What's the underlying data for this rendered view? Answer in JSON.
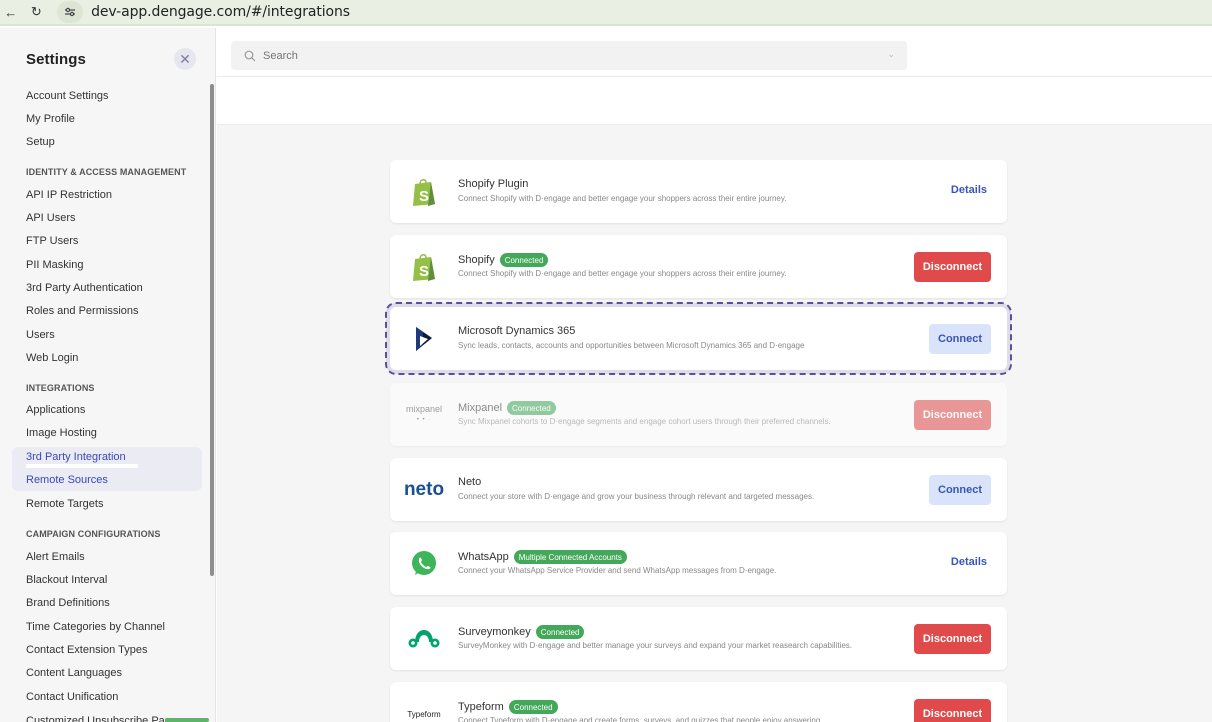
{
  "browser": {
    "back": "←",
    "reload": "↻",
    "site_info": "⚙",
    "url": "dev-app.dengage.com/#/integrations"
  },
  "sidebar": {
    "title": "Settings",
    "close": "✕",
    "items": [
      {
        "type": "item",
        "label": "Account Settings"
      },
      {
        "type": "item",
        "label": "My Profile"
      },
      {
        "type": "item",
        "label": "Setup"
      },
      {
        "type": "section",
        "label": "IDENTITY & ACCESS MANAGEMENT"
      },
      {
        "type": "item",
        "label": "API IP Restriction"
      },
      {
        "type": "item",
        "label": "API Users"
      },
      {
        "type": "item",
        "label": "FTP Users"
      },
      {
        "type": "item",
        "label": "PII Masking"
      },
      {
        "type": "item",
        "label": "3rd Party Authentication"
      },
      {
        "type": "item",
        "label": "Roles and Permissions"
      },
      {
        "type": "item",
        "label": "Users"
      },
      {
        "type": "item",
        "label": "Web Login"
      },
      {
        "type": "section",
        "label": "INTEGRATIONS"
      },
      {
        "type": "item",
        "label": "Applications"
      },
      {
        "type": "item",
        "label": "Image Hosting"
      },
      {
        "type": "item",
        "label": "3rd Party Integration",
        "link": true
      },
      {
        "type": "item",
        "label": "Remote Sources",
        "link": true
      },
      {
        "type": "item",
        "label": "Remote Targets"
      },
      {
        "type": "section",
        "label": "CAMPAIGN CONFIGURATIONS"
      },
      {
        "type": "item",
        "label": "Alert Emails"
      },
      {
        "type": "item",
        "label": "Blackout Interval"
      },
      {
        "type": "item",
        "label": "Brand Definitions"
      },
      {
        "type": "item",
        "label": "Time Categories by Channel"
      },
      {
        "type": "item",
        "label": "Contact Extension Types"
      },
      {
        "type": "item",
        "label": "Content Languages"
      },
      {
        "type": "item",
        "label": "Contact Unification"
      },
      {
        "type": "item",
        "label": "Customized Unsubscribe Page"
      }
    ]
  },
  "search": {
    "placeholder": "Search",
    "chevron": "⌄"
  },
  "integrations": [
    {
      "name": "Shopify Plugin",
      "badge": "",
      "description": "Connect Shopify with D·engage and better engage your shoppers across their entire journey.",
      "action": "details",
      "action_label": "Details",
      "logo": "shopify-icon"
    },
    {
      "name": "Shopify",
      "badge": "Connected",
      "description": "Connect Shopify with D·engage and better engage your shoppers across their entire journey.",
      "action": "disconnect",
      "action_label": "Disconnect",
      "logo": "shopify-icon"
    },
    {
      "name": "Microsoft Dynamics 365",
      "badge": "",
      "description": "Sync leads, contacts, accounts and opportunities between Microsoft Dynamics 365 and D·engage",
      "action": "connect",
      "action_label": "Connect",
      "logo": "dynamics-icon"
    },
    {
      "name": "Mixpanel",
      "badge": "Connected",
      "description": "Sync Mixpanel cohorts to D·engage segments and engage cohort users through their preferred channels.",
      "action": "disconnect",
      "action_label": "Disconnect",
      "logo": "mixpanel-logo"
    },
    {
      "name": "Neto",
      "badge": "",
      "description": "Connect your store with D·engage and grow your business through relevant and targeted messages.",
      "action": "connect",
      "action_label": "Connect",
      "logo": "neto-logo"
    },
    {
      "name": "WhatsApp",
      "badge": "Multiple Connected Accounts",
      "description": "Connect your WhatsApp Service Provider and send WhatsApp messages from D·engage.",
      "action": "details",
      "action_label": "Details",
      "logo": "whatsapp-icon"
    },
    {
      "name": "Surveymonkey",
      "badge": "Connected",
      "description": "SurveyMonkey with D·engage and better manage your surveys and expand your market reasearch capabilities.",
      "action": "disconnect",
      "action_label": "Disconnect",
      "logo": "surveymonkey-icon"
    },
    {
      "name": "Typeform",
      "badge": "Connected",
      "description": "Connect Typeform with D·engage and create forms, surveys, and quizzes that people enjoy answering.",
      "action": "disconnect",
      "action_label": "Disconnect",
      "logo": "typeform-logo"
    }
  ],
  "logos": {
    "mixpanel": "mixpanel",
    "neto": "neto",
    "typeform": "Typeform"
  },
  "colors": {
    "accent": "#3a55b5",
    "connected_badge": "#43a85a",
    "disconnect": "#e04a4a",
    "connect_bg": "#d9e4fb",
    "highlight": "#5a4f9c"
  }
}
